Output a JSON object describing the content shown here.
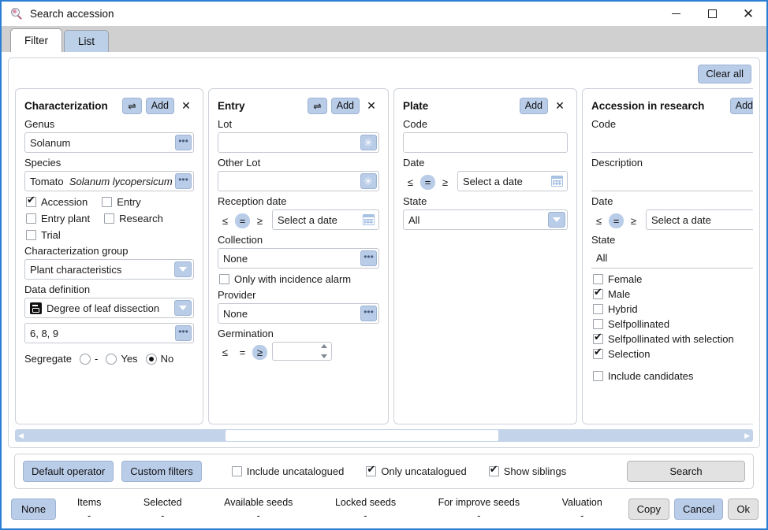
{
  "window": {
    "title": "Search accession",
    "icon": "search-accession-icon",
    "minimize": "–",
    "maximize": "□",
    "close": "✕"
  },
  "tabs": [
    {
      "label": "Filter",
      "active": true
    },
    {
      "label": "List",
      "active": false
    }
  ],
  "toolbar": {
    "clear_all": "Clear all"
  },
  "panels": {
    "characterization": {
      "title": "Characterization",
      "actions": {
        "operator": "⇌",
        "add": "Add",
        "close": "✕"
      },
      "genus_label": "Genus",
      "genus_value": "Solanum",
      "species_label": "Species",
      "species_common": "Tomato",
      "species_scientific": "Solanum lycopersicum",
      "checkboxes": [
        {
          "label": "Accession",
          "checked": true
        },
        {
          "label": "Entry",
          "checked": false
        },
        {
          "label": "Entry plant",
          "checked": false
        },
        {
          "label": "Research",
          "checked": false
        },
        {
          "label": "Trial",
          "checked": false
        }
      ],
      "group_label": "Characterization group",
      "group_value": "Plant characteristics",
      "datadef_label": "Data definition",
      "datadef_value": "Degree of leaf dissection",
      "datadef_icon": "data-definition-icon",
      "values_value": "6, 8, 9",
      "segregate_label": "Segregate",
      "segregate_options": [
        {
          "label": "-",
          "selected": false
        },
        {
          "label": "Yes",
          "selected": false
        },
        {
          "label": "No",
          "selected": true
        }
      ]
    },
    "entry": {
      "title": "Entry",
      "actions": {
        "operator": "⇌",
        "add": "Add",
        "close": "✕"
      },
      "lot_label": "Lot",
      "lot_value": "",
      "other_lot_label": "Other Lot",
      "other_lot_value": "",
      "reception_label": "Reception date",
      "reception_ops": [
        {
          "label": "≤",
          "selected": false
        },
        {
          "label": "=",
          "selected": true
        },
        {
          "label": "≥",
          "selected": false
        }
      ],
      "reception_value": "Select a date",
      "collection_label": "Collection",
      "collection_value": "None",
      "incidence_label": "Only with incidence alarm",
      "incidence_checked": false,
      "provider_label": "Provider",
      "provider_value": "None",
      "germination_label": "Germination",
      "germination_ops": [
        {
          "label": "≤",
          "selected": false
        },
        {
          "label": "=",
          "selected": false
        },
        {
          "label": "≥",
          "selected": true
        }
      ],
      "germination_value": ""
    },
    "plate": {
      "title": "Plate",
      "actions": {
        "add": "Add",
        "close": "✕"
      },
      "code_label": "Code",
      "code_value": "",
      "date_label": "Date",
      "date_ops": [
        {
          "label": "≤",
          "selected": false
        },
        {
          "label": "=",
          "selected": true
        },
        {
          "label": "≥",
          "selected": false
        }
      ],
      "date_value": "Select a date",
      "state_label": "State",
      "state_value": "All"
    },
    "research": {
      "title": "Accession in research",
      "actions": {
        "add": "Add"
      },
      "code_label": "Code",
      "code_value": "",
      "description_label": "Description",
      "description_value": "",
      "date_label": "Date",
      "date_ops": [
        {
          "label": "≤",
          "selected": false
        },
        {
          "label": "=",
          "selected": true
        },
        {
          "label": "≥",
          "selected": false
        }
      ],
      "date_value": "Select a date",
      "state_label": "State",
      "state_value": "All",
      "checkboxes": [
        {
          "label": "Female",
          "checked": false
        },
        {
          "label": "Male",
          "checked": true
        },
        {
          "label": "Hybrid",
          "checked": false
        },
        {
          "label": "Selfpollinated",
          "checked": false
        },
        {
          "label": "Selfpollinated with selection",
          "checked": true
        },
        {
          "label": "Selection",
          "checked": true
        }
      ],
      "include_candidates_label": "Include candidates",
      "include_candidates_checked": false
    }
  },
  "options": {
    "default_operator": "Default operator",
    "custom_filters": "Custom filters",
    "include_uncatalogued": {
      "label": "Include uncatalogued",
      "checked": false
    },
    "only_uncatalogued": {
      "label": "Only uncatalogued",
      "checked": true
    },
    "show_siblings": {
      "label": "Show siblings",
      "checked": true
    },
    "search": "Search"
  },
  "status": {
    "none_button": "None",
    "metrics": [
      {
        "label": "Items",
        "value": "-"
      },
      {
        "label": "Selected",
        "value": "-"
      },
      {
        "label": "Available seeds",
        "value": "-"
      },
      {
        "label": "Locked seeds",
        "value": "-"
      },
      {
        "label": "For improve seeds",
        "value": "-"
      },
      {
        "label": "Valuation",
        "value": "-"
      }
    ],
    "copy": "Copy",
    "cancel": "Cancel",
    "ok": "Ok"
  },
  "colors": {
    "accent": "#b9cce8",
    "border": "#2a7fd4",
    "tabstrip": "#d0d0d0"
  }
}
